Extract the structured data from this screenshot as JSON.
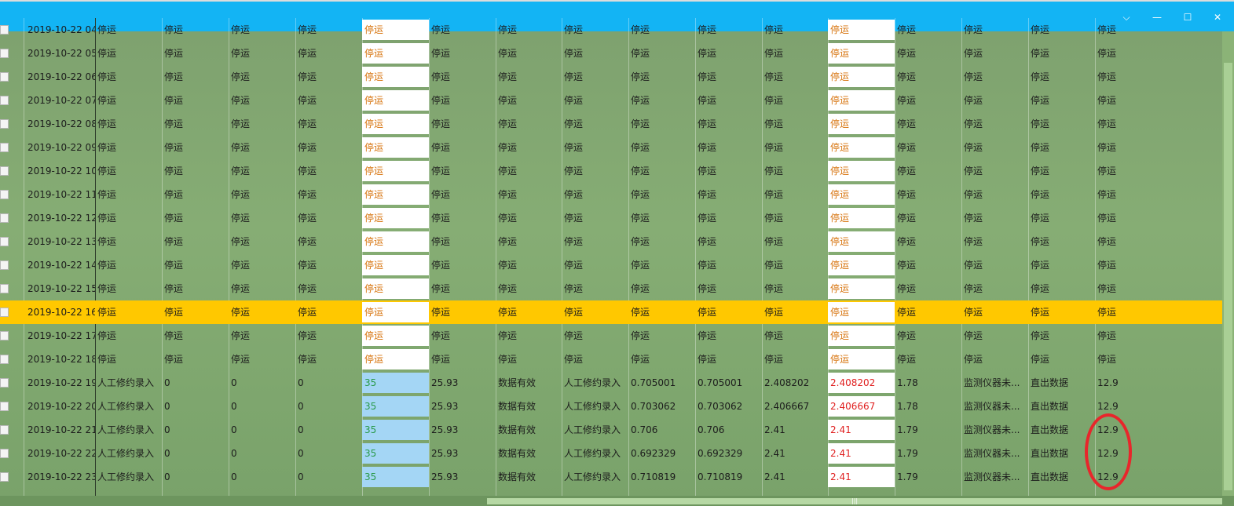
{
  "titlebar": {
    "color": "#13b4f4",
    "controls": [
      {
        "name": "collapse",
        "icon": "chevron-down-icon",
        "glyph": "⌵"
      },
      {
        "name": "minimize",
        "icon": "minimize-icon",
        "glyph": "—"
      },
      {
        "name": "maximize",
        "icon": "maximize-icon",
        "glyph": "☐"
      },
      {
        "name": "close",
        "icon": "close-icon",
        "glyph": "✕"
      }
    ]
  },
  "highlight_color": "#ffc800",
  "rows": [
    {
      "time": "2019-10-22 04",
      "cells": [
        "停运",
        "停运",
        "停运",
        "停运",
        "停运",
        "停运",
        "停运",
        "停运",
        "停运",
        "停运",
        "停运",
        "停运",
        "停运",
        "停运",
        "停运",
        "停运"
      ],
      "highlight": false,
      "data": false
    },
    {
      "time": "2019-10-22 05",
      "cells": [
        "停运",
        "停运",
        "停运",
        "停运",
        "停运",
        "停运",
        "停运",
        "停运",
        "停运",
        "停运",
        "停运",
        "停运",
        "停运",
        "停运",
        "停运",
        "停运"
      ],
      "highlight": false,
      "data": false
    },
    {
      "time": "2019-10-22 06",
      "cells": [
        "停运",
        "停运",
        "停运",
        "停运",
        "停运",
        "停运",
        "停运",
        "停运",
        "停运",
        "停运",
        "停运",
        "停运",
        "停运",
        "停运",
        "停运",
        "停运"
      ],
      "highlight": false,
      "data": false
    },
    {
      "time": "2019-10-22 07",
      "cells": [
        "停运",
        "停运",
        "停运",
        "停运",
        "停运",
        "停运",
        "停运",
        "停运",
        "停运",
        "停运",
        "停运",
        "停运",
        "停运",
        "停运",
        "停运",
        "停运"
      ],
      "highlight": false,
      "data": false
    },
    {
      "time": "2019-10-22 08",
      "cells": [
        "停运",
        "停运",
        "停运",
        "停运",
        "停运",
        "停运",
        "停运",
        "停运",
        "停运",
        "停运",
        "停运",
        "停运",
        "停运",
        "停运",
        "停运",
        "停运"
      ],
      "highlight": false,
      "data": false
    },
    {
      "time": "2019-10-22 09",
      "cells": [
        "停运",
        "停运",
        "停运",
        "停运",
        "停运",
        "停运",
        "停运",
        "停运",
        "停运",
        "停运",
        "停运",
        "停运",
        "停运",
        "停运",
        "停运",
        "停运"
      ],
      "highlight": false,
      "data": false
    },
    {
      "time": "2019-10-22 10",
      "cells": [
        "停运",
        "停运",
        "停运",
        "停运",
        "停运",
        "停运",
        "停运",
        "停运",
        "停运",
        "停运",
        "停运",
        "停运",
        "停运",
        "停运",
        "停运",
        "停运"
      ],
      "highlight": false,
      "data": false
    },
    {
      "time": "2019-10-22 11",
      "cells": [
        "停运",
        "停运",
        "停运",
        "停运",
        "停运",
        "停运",
        "停运",
        "停运",
        "停运",
        "停运",
        "停运",
        "停运",
        "停运",
        "停运",
        "停运",
        "停运"
      ],
      "highlight": false,
      "data": false
    },
    {
      "time": "2019-10-22 12",
      "cells": [
        "停运",
        "停运",
        "停运",
        "停运",
        "停运",
        "停运",
        "停运",
        "停运",
        "停运",
        "停运",
        "停运",
        "停运",
        "停运",
        "停运",
        "停运",
        "停运"
      ],
      "highlight": false,
      "data": false
    },
    {
      "time": "2019-10-22 13",
      "cells": [
        "停运",
        "停运",
        "停运",
        "停运",
        "停运",
        "停运",
        "停运",
        "停运",
        "停运",
        "停运",
        "停运",
        "停运",
        "停运",
        "停运",
        "停运",
        "停运"
      ],
      "highlight": false,
      "data": false
    },
    {
      "time": "2019-10-22 14",
      "cells": [
        "停运",
        "停运",
        "停运",
        "停运",
        "停运",
        "停运",
        "停运",
        "停运",
        "停运",
        "停运",
        "停运",
        "停运",
        "停运",
        "停运",
        "停运",
        "停运"
      ],
      "highlight": false,
      "data": false
    },
    {
      "time": "2019-10-22 15",
      "cells": [
        "停运",
        "停运",
        "停运",
        "停运",
        "停运",
        "停运",
        "停运",
        "停运",
        "停运",
        "停运",
        "停运",
        "停运",
        "停运",
        "停运",
        "停运",
        "停运"
      ],
      "highlight": false,
      "data": false
    },
    {
      "time": "2019-10-22 16",
      "cells": [
        "停运",
        "停运",
        "停运",
        "停运",
        "停运",
        "停运",
        "停运",
        "停运",
        "停运",
        "停运",
        "停运",
        "停运",
        "停运",
        "停运",
        "停运",
        "停运"
      ],
      "highlight": true,
      "data": false
    },
    {
      "time": "2019-10-22 17",
      "cells": [
        "停运",
        "停运",
        "停运",
        "停运",
        "停运",
        "停运",
        "停运",
        "停运",
        "停运",
        "停运",
        "停运",
        "停运",
        "停运",
        "停运",
        "停运",
        "停运"
      ],
      "highlight": false,
      "data": false
    },
    {
      "time": "2019-10-22 18",
      "cells": [
        "停运",
        "停运",
        "停运",
        "停运",
        "停运",
        "停运",
        "停运",
        "停运",
        "停运",
        "停运",
        "停运",
        "停运",
        "停运",
        "停运",
        "停运",
        "停运"
      ],
      "highlight": false,
      "data": false
    },
    {
      "time": "2019-10-22 19",
      "cells": [
        "人工修约录入",
        "0",
        "0",
        "0",
        "35",
        "25.93",
        "数据有效",
        "人工修约录入",
        "0.705001",
        "0.705001",
        "2.408202",
        "2.408202",
        "1.78",
        "监测仪器未...",
        "直出数据",
        "12.9"
      ],
      "highlight": false,
      "data": true
    },
    {
      "time": "2019-10-22 20",
      "cells": [
        "人工修约录入",
        "0",
        "0",
        "0",
        "35",
        "25.93",
        "数据有效",
        "人工修约录入",
        "0.703062",
        "0.703062",
        "2.406667",
        "2.406667",
        "1.78",
        "监测仪器未...",
        "直出数据",
        "12.9"
      ],
      "highlight": false,
      "data": true
    },
    {
      "time": "2019-10-22 21",
      "cells": [
        "人工修约录入",
        "0",
        "0",
        "0",
        "35",
        "25.93",
        "数据有效",
        "人工修约录入",
        "0.706",
        "0.706",
        "2.41",
        "2.41",
        "1.79",
        "监测仪器未...",
        "直出数据",
        "12.9"
      ],
      "highlight": false,
      "data": true
    },
    {
      "time": "2019-10-22 22",
      "cells": [
        "人工修约录入",
        "0",
        "0",
        "0",
        "35",
        "25.93",
        "数据有效",
        "人工修约录入",
        "0.692329",
        "0.692329",
        "2.41",
        "2.41",
        "1.79",
        "监测仪器未...",
        "直出数据",
        "12.9"
      ],
      "highlight": false,
      "data": true
    },
    {
      "time": "2019-10-22 23",
      "cells": [
        "人工修约录入",
        "0",
        "0",
        "0",
        "35",
        "25.93",
        "数据有效",
        "人工修约录入",
        "0.710819",
        "0.710819",
        "2.41",
        "2.41",
        "1.79",
        "监测仪器未...",
        "直出数据",
        "12.9"
      ],
      "highlight": false,
      "data": true
    }
  ]
}
